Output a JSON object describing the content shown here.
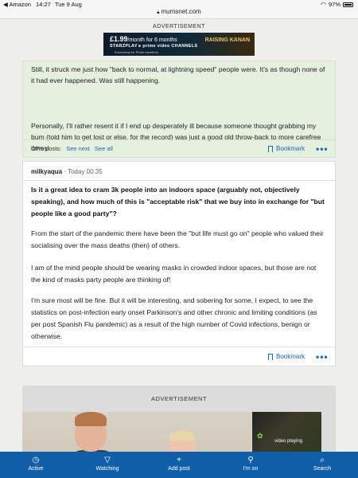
{
  "status_bar": {
    "back_app": "◀ Amazon",
    "time": "14:27",
    "date": "Tue 9 Aug",
    "battery": "97%"
  },
  "url_bar": {
    "domain": "mumsnet.com"
  },
  "ad_top": {
    "label": "ADVERTISEMENT",
    "price": "£1.99",
    "price_suffix": "/month for 6 months",
    "brand": "STARZPLAY ▸ prime video CHANNELS",
    "exclusive": "Exclusively for Prime members",
    "show": "RAISING KANAN"
  },
  "post_prev": {
    "paragraph1": "Still, it struck me just how \"back to normal, at lightning speed\" people were. It's as though none of it had ever happened. Was still happening.",
    "paragraph2": "Personally, I'll rather resent it if I end up desperately ill because someone thought grabbing my bum (told him to get lost or else, for the record) was just a good old throw-back to more carefree times!",
    "ops_label": "OP's posts:",
    "see_next": "See next",
    "see_all": "See all",
    "bookmark": "Bookmark",
    "more": "•••"
  },
  "post": {
    "author": "milkyaqua",
    "timestamp": " · Today 00:35",
    "question": "Is it a great idea to cram 3k people into an indoors space (arguably not, objectively speaking), and how much of this is \"acceptable risk\" that we buy into in exchange for \"but people like a good party\"?",
    "para1": "From the start of the pandemic there have been the \"but life must go on\" people who valued their socialising over the mass deaths (then) of others.",
    "para2": "I am of the mind people should be wearing masks in crowded indoor spaces, but those are not the kind of masks party people are thinking of!",
    "para3": "I'm sure most will be fine. But it will be interesting, and sobering for some, I expect, to see the statistics on post-infection early onset Parkinson's and other chronic and limiting conditions (as per post Spanish Flu pandemic) as a result of the high number of Covid infections, benign or otherwise.",
    "bookmark": "Bookmark",
    "more": "•••"
  },
  "ad_bottom": {
    "label": "ADVERTISEMENT",
    "video_label": "video playing"
  },
  "tabbar": [
    {
      "label": "Active",
      "icon": "clock-icon",
      "glyph": "◷"
    },
    {
      "label": "Watching",
      "icon": "filter-icon",
      "glyph": "▽"
    },
    {
      "label": "Add post",
      "icon": "plus-icon",
      "glyph": "+"
    },
    {
      "label": "I'm on",
      "icon": "pin-icon",
      "glyph": "⚲"
    },
    {
      "label": "Search",
      "icon": "search-icon",
      "glyph": "⌕"
    }
  ],
  "colors": {
    "link": "#1a67b5",
    "tabbar_bg": "#0e5ea8",
    "highlight_post_bg": "#e6f0df"
  }
}
